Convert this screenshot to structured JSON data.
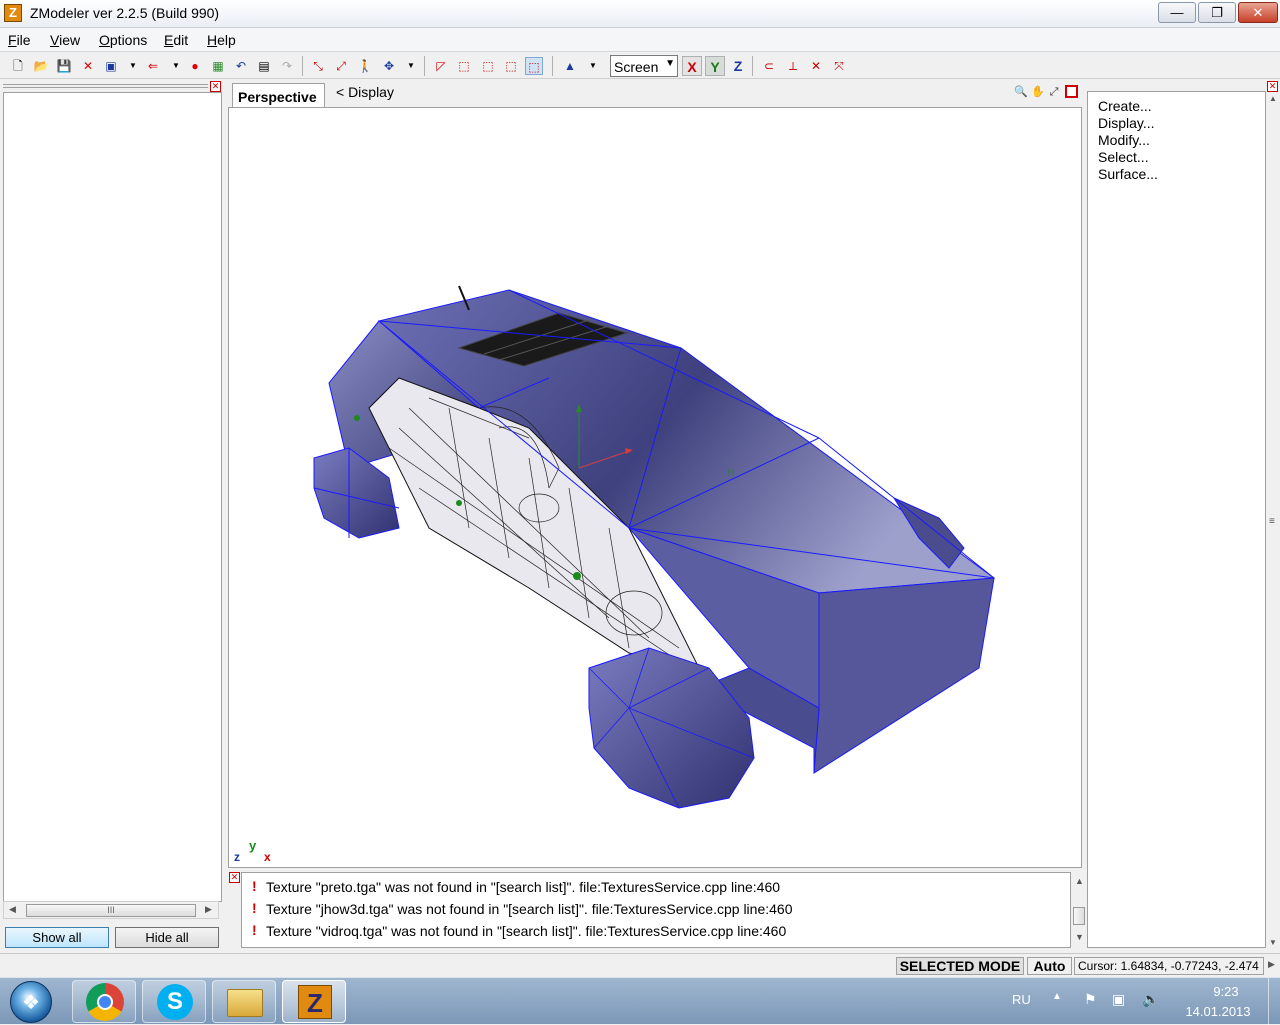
{
  "window": {
    "title": "ZModeler ver 2.2.5 (Build 990)",
    "app_icon_letter": "Z",
    "minimize_glyph": "—",
    "maximize_glyph": "❐",
    "close_glyph": "✕"
  },
  "menu": [
    {
      "label_u": "F",
      "label_rest": "ile"
    },
    {
      "label_u": "V",
      "label_rest": "iew"
    },
    {
      "label_u": "O",
      "label_rest": "ptions"
    },
    {
      "label_u": "E",
      "label_rest": "dit"
    },
    {
      "label_u": "H",
      "label_rest": "elp"
    }
  ],
  "toolbar": {
    "view_select_value": "Screen",
    "axis_x": "X",
    "axis_y": "Y",
    "axis_z": "Z"
  },
  "left_panel": {
    "show_all_label": "Show all",
    "hide_all_label": "Hide all",
    "hscroll_grip": "III"
  },
  "viewport": {
    "tab_label": "Perspective",
    "display_label": "<  Display",
    "axis_gizmo": {
      "z": "z",
      "y": "y",
      "x": "x"
    }
  },
  "log": {
    "entries": [
      "Texture \"preto.tga\" was not found in \"[search list]\". file:TexturesService.cpp line:460",
      "Texture \"jhow3d.tga\" was not found in \"[search list]\". file:TexturesService.cpp line:460",
      "Texture \"vidroq.tga\" was not found in \"[search list]\". file:TexturesService.cpp line:460"
    ],
    "bang": "!"
  },
  "right_panel": {
    "items": [
      "Create...",
      "Display...",
      "Modify...",
      "Select...",
      "Surface..."
    ]
  },
  "status": {
    "mode": "SELECTED MODE",
    "auto": "Auto",
    "cursor": "Cursor: 1.64834, -0.77243, -2.474"
  },
  "taskbar": {
    "apps": [
      "chrome-icon",
      "skype-icon",
      "explorer-icon",
      "zmodeler-icon"
    ],
    "lang": "RU",
    "time": "9:23",
    "date": "14.01.2013"
  },
  "colors": {
    "mesh_fill": "#5c5e9e",
    "mesh_edge": "#1a1aff",
    "accent": "#3c7fb1"
  }
}
